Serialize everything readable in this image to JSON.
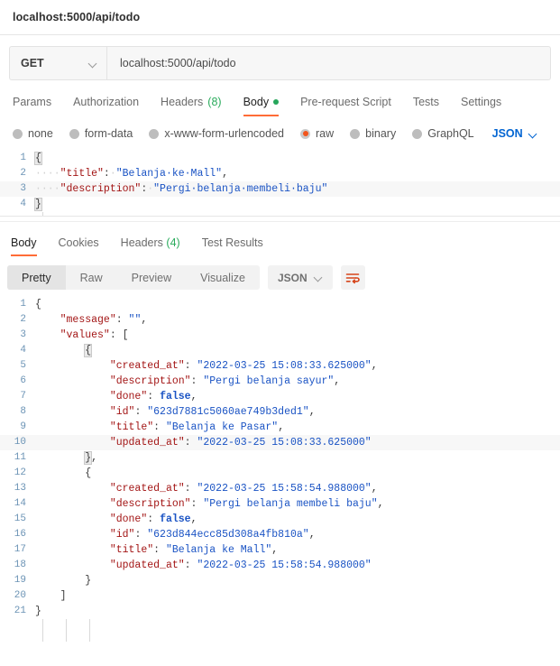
{
  "window": {
    "title": "localhost:5000/api/todo"
  },
  "request": {
    "method": "GET",
    "method_icon": "chevron-down-icon",
    "url": "localhost:5000/api/todo",
    "tabs": [
      {
        "label": "Params",
        "active": false
      },
      {
        "label": "Authorization",
        "active": false
      },
      {
        "label": "Headers",
        "count": "(8)",
        "active": false
      },
      {
        "label": "Body",
        "active": true,
        "dot": true
      },
      {
        "label": "Pre-request Script",
        "active": false
      },
      {
        "label": "Tests",
        "active": false
      },
      {
        "label": "Settings",
        "active": false
      }
    ],
    "body_types": [
      {
        "label": "none",
        "selected": false
      },
      {
        "label": "form-data",
        "selected": false
      },
      {
        "label": "x-www-form-urlencoded",
        "selected": false
      },
      {
        "label": "raw",
        "selected": true
      },
      {
        "label": "binary",
        "selected": false
      },
      {
        "label": "GraphQL",
        "selected": false
      }
    ],
    "format_select": "JSON",
    "body_lines": [
      {
        "n": "1",
        "highlight": false,
        "tokens": [
          {
            "t": "{",
            "c": "brace"
          }
        ]
      },
      {
        "n": "2",
        "highlight": false,
        "tokens": [
          {
            "t": "····",
            "c": "ws"
          },
          {
            "t": "\"title\"",
            "c": "k"
          },
          {
            "t": ":",
            "c": "p"
          },
          {
            "t": "·",
            "c": "ws"
          },
          {
            "t": "\"Belanja·ke·Mall\"",
            "c": "s"
          },
          {
            "t": ",",
            "c": "p"
          }
        ]
      },
      {
        "n": "3",
        "highlight": true,
        "tokens": [
          {
            "t": "····",
            "c": "ws"
          },
          {
            "t": "\"description\"",
            "c": "k"
          },
          {
            "t": ":",
            "c": "p"
          },
          {
            "t": "·",
            "c": "ws"
          },
          {
            "t": "\"Pergi·belanja·membeli·baju\"",
            "c": "s"
          }
        ]
      },
      {
        "n": "4",
        "highlight": false,
        "tokens": [
          {
            "t": "}",
            "c": "brace"
          }
        ]
      }
    ]
  },
  "response": {
    "tabs": [
      {
        "label": "Body",
        "active": true
      },
      {
        "label": "Cookies",
        "active": false
      },
      {
        "label": "Headers",
        "count": "(4)",
        "active": false
      },
      {
        "label": "Test Results",
        "active": false
      }
    ],
    "view_modes": [
      {
        "label": "Pretty",
        "active": true
      },
      {
        "label": "Raw",
        "active": false
      },
      {
        "label": "Preview",
        "active": false
      },
      {
        "label": "Visualize",
        "active": false
      }
    ],
    "format_select": "JSON",
    "wrap_icon": "word-wrap-icon",
    "body_lines": [
      {
        "n": "1",
        "highlight": false,
        "tokens": [
          {
            "t": "{",
            "c": "p"
          }
        ]
      },
      {
        "n": "2",
        "highlight": false,
        "tokens": [
          {
            "t": "    ",
            "c": "p"
          },
          {
            "t": "\"message\"",
            "c": "k"
          },
          {
            "t": ": ",
            "c": "p"
          },
          {
            "t": "\"\"",
            "c": "s"
          },
          {
            "t": ",",
            "c": "p"
          }
        ]
      },
      {
        "n": "3",
        "highlight": false,
        "tokens": [
          {
            "t": "    ",
            "c": "p"
          },
          {
            "t": "\"values\"",
            "c": "k"
          },
          {
            "t": ": ",
            "c": "p"
          },
          {
            "t": "[",
            "c": "p"
          }
        ]
      },
      {
        "n": "4",
        "highlight": false,
        "tokens": [
          {
            "t": "        ",
            "c": "p"
          },
          {
            "t": "{",
            "c": "brace"
          }
        ]
      },
      {
        "n": "5",
        "highlight": false,
        "tokens": [
          {
            "t": "            ",
            "c": "p"
          },
          {
            "t": "\"created_at\"",
            "c": "k"
          },
          {
            "t": ": ",
            "c": "p"
          },
          {
            "t": "\"2022-03-25 15:08:33.625000\"",
            "c": "s"
          },
          {
            "t": ",",
            "c": "p"
          }
        ]
      },
      {
        "n": "6",
        "highlight": false,
        "tokens": [
          {
            "t": "            ",
            "c": "p"
          },
          {
            "t": "\"description\"",
            "c": "k"
          },
          {
            "t": ": ",
            "c": "p"
          },
          {
            "t": "\"Pergi belanja sayur\"",
            "c": "s"
          },
          {
            "t": ",",
            "c": "p"
          }
        ]
      },
      {
        "n": "7",
        "highlight": false,
        "tokens": [
          {
            "t": "            ",
            "c": "p"
          },
          {
            "t": "\"done\"",
            "c": "k"
          },
          {
            "t": ": ",
            "c": "p"
          },
          {
            "t": "false",
            "c": "b"
          },
          {
            "t": ",",
            "c": "p"
          }
        ]
      },
      {
        "n": "8",
        "highlight": false,
        "tokens": [
          {
            "t": "            ",
            "c": "p"
          },
          {
            "t": "\"id\"",
            "c": "k"
          },
          {
            "t": ": ",
            "c": "p"
          },
          {
            "t": "\"623d7881c5060ae749b3ded1\"",
            "c": "s"
          },
          {
            "t": ",",
            "c": "p"
          }
        ]
      },
      {
        "n": "9",
        "highlight": false,
        "tokens": [
          {
            "t": "            ",
            "c": "p"
          },
          {
            "t": "\"title\"",
            "c": "k"
          },
          {
            "t": ": ",
            "c": "p"
          },
          {
            "t": "\"Belanja ke Pasar\"",
            "c": "s"
          },
          {
            "t": ",",
            "c": "p"
          }
        ]
      },
      {
        "n": "10",
        "highlight": true,
        "tokens": [
          {
            "t": "            ",
            "c": "p"
          },
          {
            "t": "\"updated_at\"",
            "c": "k"
          },
          {
            "t": ": ",
            "c": "p"
          },
          {
            "t": "\"2022-03-25 15:08:33.625000\"",
            "c": "s"
          }
        ]
      },
      {
        "n": "11",
        "highlight": false,
        "tokens": [
          {
            "t": "        ",
            "c": "p"
          },
          {
            "t": "}",
            "c": "brace"
          },
          {
            "t": ",",
            "c": "p"
          }
        ]
      },
      {
        "n": "12",
        "highlight": false,
        "tokens": [
          {
            "t": "        ",
            "c": "p"
          },
          {
            "t": "{",
            "c": "p"
          }
        ]
      },
      {
        "n": "13",
        "highlight": false,
        "tokens": [
          {
            "t": "            ",
            "c": "p"
          },
          {
            "t": "\"created_at\"",
            "c": "k"
          },
          {
            "t": ": ",
            "c": "p"
          },
          {
            "t": "\"2022-03-25 15:58:54.988000\"",
            "c": "s"
          },
          {
            "t": ",",
            "c": "p"
          }
        ]
      },
      {
        "n": "14",
        "highlight": false,
        "tokens": [
          {
            "t": "            ",
            "c": "p"
          },
          {
            "t": "\"description\"",
            "c": "k"
          },
          {
            "t": ": ",
            "c": "p"
          },
          {
            "t": "\"Pergi belanja membeli baju\"",
            "c": "s"
          },
          {
            "t": ",",
            "c": "p"
          }
        ]
      },
      {
        "n": "15",
        "highlight": false,
        "tokens": [
          {
            "t": "            ",
            "c": "p"
          },
          {
            "t": "\"done\"",
            "c": "k"
          },
          {
            "t": ": ",
            "c": "p"
          },
          {
            "t": "false",
            "c": "b"
          },
          {
            "t": ",",
            "c": "p"
          }
        ]
      },
      {
        "n": "16",
        "highlight": false,
        "tokens": [
          {
            "t": "            ",
            "c": "p"
          },
          {
            "t": "\"id\"",
            "c": "k"
          },
          {
            "t": ": ",
            "c": "p"
          },
          {
            "t": "\"623d844ecc85d308a4fb810a\"",
            "c": "s"
          },
          {
            "t": ",",
            "c": "p"
          }
        ]
      },
      {
        "n": "17",
        "highlight": false,
        "tokens": [
          {
            "t": "            ",
            "c": "p"
          },
          {
            "t": "\"title\"",
            "c": "k"
          },
          {
            "t": ": ",
            "c": "p"
          },
          {
            "t": "\"Belanja ke Mall\"",
            "c": "s"
          },
          {
            "t": ",",
            "c": "p"
          }
        ]
      },
      {
        "n": "18",
        "highlight": false,
        "tokens": [
          {
            "t": "            ",
            "c": "p"
          },
          {
            "t": "\"updated_at\"",
            "c": "k"
          },
          {
            "t": ": ",
            "c": "p"
          },
          {
            "t": "\"2022-03-25 15:58:54.988000\"",
            "c": "s"
          }
        ]
      },
      {
        "n": "19",
        "highlight": false,
        "tokens": [
          {
            "t": "        ",
            "c": "p"
          },
          {
            "t": "}",
            "c": "p"
          }
        ]
      },
      {
        "n": "20",
        "highlight": false,
        "tokens": [
          {
            "t": "    ",
            "c": "p"
          },
          {
            "t": "]",
            "c": "p"
          }
        ]
      },
      {
        "n": "21",
        "highlight": false,
        "tokens": [
          {
            "t": "}",
            "c": "p"
          }
        ]
      }
    ]
  },
  "colors": {
    "accent_orange": "#ff6c37",
    "green": "#2aab5c",
    "link_blue": "#0265d2",
    "json_key": "#a31515",
    "json_string": "#1a53c4",
    "gutter_number": "#6b93b5"
  }
}
